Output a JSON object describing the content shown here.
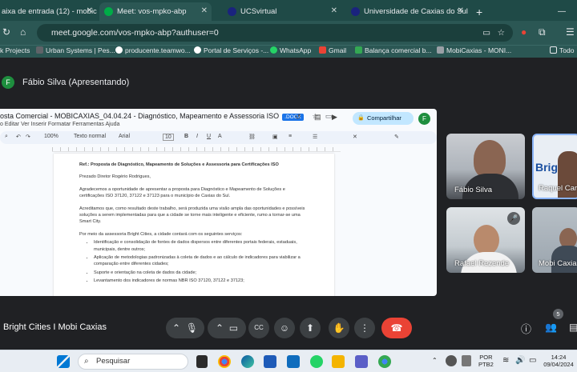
{
  "tabs": [
    {
      "label": "aixa de entrada (12) - mobica",
      "icon_color": "#ea4335"
    },
    {
      "label": "Meet: vos-mpko-abp",
      "icon_color": "#00ac47"
    },
    {
      "label": "UCSvirtual",
      "icon_color": "#1a237e"
    },
    {
      "label": "Universidade de Caxias do Sul",
      "icon_color": "#1a237e"
    }
  ],
  "address": {
    "url": "meet.google.com/vos-mpko-abp?authuser=0"
  },
  "bookmarks": [
    "k Projects",
    "Urban Systems | Pes...",
    "producente.teamwo...",
    "Portal de Serviços -...",
    "WhatsApp",
    "Gmail",
    "Balança comercial b...",
    "MobiCaxias - MONI...",
    "Todo"
  ],
  "meet": {
    "presenter_initial": "F",
    "presenter_label": "Fábio Silva (Apresentando)",
    "meeting_title": "Bright Cities I Mobi Caxias",
    "participants_count": "5",
    "participants": [
      {
        "name": "Fábio Silva"
      },
      {
        "name": "Raquel Car"
      },
      {
        "name": "Rafael Rezende"
      },
      {
        "name": "Mobi Caxia"
      }
    ]
  },
  "doc": {
    "title": "osta Comercial - MOBICAXIAS_04.04.24 - Diagnóstico, Mapeamento e Assessoria ISO",
    "badge": ".DOCX",
    "menu": "o   Editar   Ver   Inserir   Formatar   Ferramentas   Ajuda",
    "share": "Compartilhar",
    "avatar": "F",
    "zoom": "100%",
    "style": "Texto normal",
    "font": "Arial",
    "size": "10",
    "ref": "Ref.:    Proposta de Diagnóstico, Mapeamento de Soluções e Assessoria para Certificações ISO",
    "salutation": "Prezado Diretor Rogério Rodrigues,",
    "p1": "Agradecemos a oportunidade de apresentar a proposta para Diagnóstico e Mapeamento de Soluções e certificações ISO 37120, 37122 e 37123 para o município de Caxias do Sul.",
    "p2": "Acreditamos que, como resultado deste trabalho, será produzida uma visão ampla das oportunidades e possíveis soluções a serem implementadas para que a cidade se torne mais inteligente e eficiente, rumo a tornar-se uma Smart City.",
    "p3": "Por meio da assessoria Bright Cities, a cidade contará com os seguintes serviços:",
    "bullets": [
      "Identificação e consolidação de fontes de dados dispersos entre diferentes portais federais, estaduais, municipais, dentre outros;",
      "Aplicação de metodologias padronizadas à coleta de dados e ao cálculo de indicadores para viabilizar a comparação entre diferentes cidades;",
      "Suporte e orientação na coleta de dados da cidade;",
      "Levantamento dos indicadores de normas NBR ISO 37120, 37122 e 37123;"
    ]
  },
  "taskbar": {
    "search": "Pesquisar",
    "lang": "POR",
    "layout": "PTB2",
    "time": "14:24",
    "date": "09/04/2024"
  }
}
